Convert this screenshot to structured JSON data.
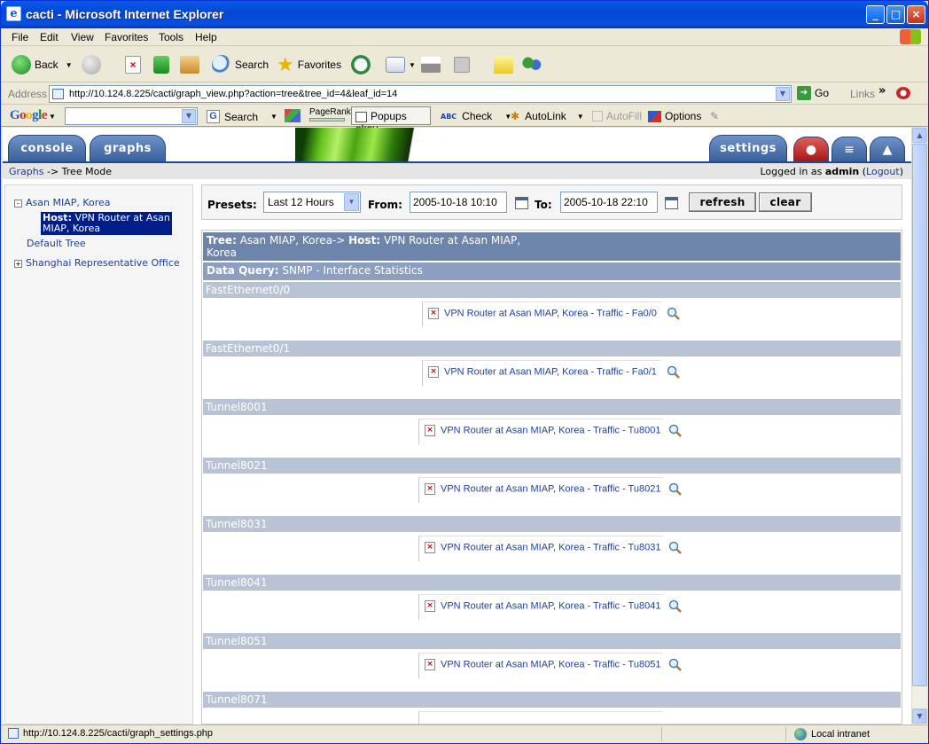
{
  "window": {
    "title": "cacti - Microsoft Internet Explorer"
  },
  "menu": [
    "File",
    "Edit",
    "View",
    "Favorites",
    "Tools",
    "Help"
  ],
  "toolbar": {
    "back": "Back",
    "search": "Search",
    "favorites": "Favorites"
  },
  "address": {
    "label": "Address",
    "url": "http://10.124.8.225/cacti/graph_view.php?action=tree&tree_id=4&leaf_id=14",
    "go": "Go",
    "links": "Links"
  },
  "googlebar": {
    "logo": "Google",
    "search": "Search",
    "pagerank": "PageRank",
    "popups": "Popups okay",
    "check": "Check",
    "autolink": "AutoLink",
    "autofill": "AutoFill",
    "options": "Options"
  },
  "tabs": {
    "console": "console",
    "graphs": "graphs",
    "settings": "settings"
  },
  "nav": {
    "crumb_link": "Graphs",
    "crumb_rest": " -> Tree Mode",
    "logged_prefix": "Logged in as ",
    "user": "admin",
    "logout": "Logout"
  },
  "tree": {
    "items": [
      {
        "label": "Asan MIAP, Korea",
        "expander": "-"
      },
      {
        "label": "Default Tree"
      },
      {
        "label": "Shanghai Representative Office",
        "expander": "+"
      }
    ],
    "selected": {
      "prefix": "Host:",
      "label": "VPN Router at Asan MIAP, Korea"
    }
  },
  "filter": {
    "presets_label": "Presets:",
    "preset": "Last 12 Hours",
    "from_label": "From:",
    "from": "2005-10-18 10:10",
    "to_label": "To:",
    "to": "2005-10-18 22:10",
    "refresh": "refresh",
    "clear": "clear"
  },
  "header": {
    "tree_label": "Tree:",
    "tree_value": "Asan MIAP, Korea->",
    "host_label": "Host:",
    "host_value": "VPN Router at Asan MIAP,",
    "host_value2": "Korea",
    "dq_label": "Data Query:",
    "dq_value": "SNMP - Interface Statistics"
  },
  "sections": [
    {
      "name": "FastEthernet0/0",
      "graph": "VPN Router at Asan MIAP, Korea - Traffic - Fa0/0"
    },
    {
      "name": "FastEthernet0/1",
      "graph": "VPN Router at Asan MIAP, Korea - Traffic - Fa0/1"
    },
    {
      "name": "Tunnel8001",
      "graph": "VPN Router at Asan MIAP, Korea - Traffic - Tu8001"
    },
    {
      "name": "Tunnel8021",
      "graph": "VPN Router at Asan MIAP, Korea - Traffic - Tu8021"
    },
    {
      "name": "Tunnel8031",
      "graph": "VPN Router at Asan MIAP, Korea - Traffic - Tu8031"
    },
    {
      "name": "Tunnel8041",
      "graph": "VPN Router at Asan MIAP, Korea - Traffic - Tu8041"
    },
    {
      "name": "Tunnel8051",
      "graph": "VPN Router at Asan MIAP, Korea - Traffic - Tu8051"
    },
    {
      "name": "Tunnel8071",
      "graph": ""
    }
  ],
  "status": {
    "url": "http://10.124.8.225/cacti/graph_settings.php",
    "zone": "Local intranet"
  }
}
